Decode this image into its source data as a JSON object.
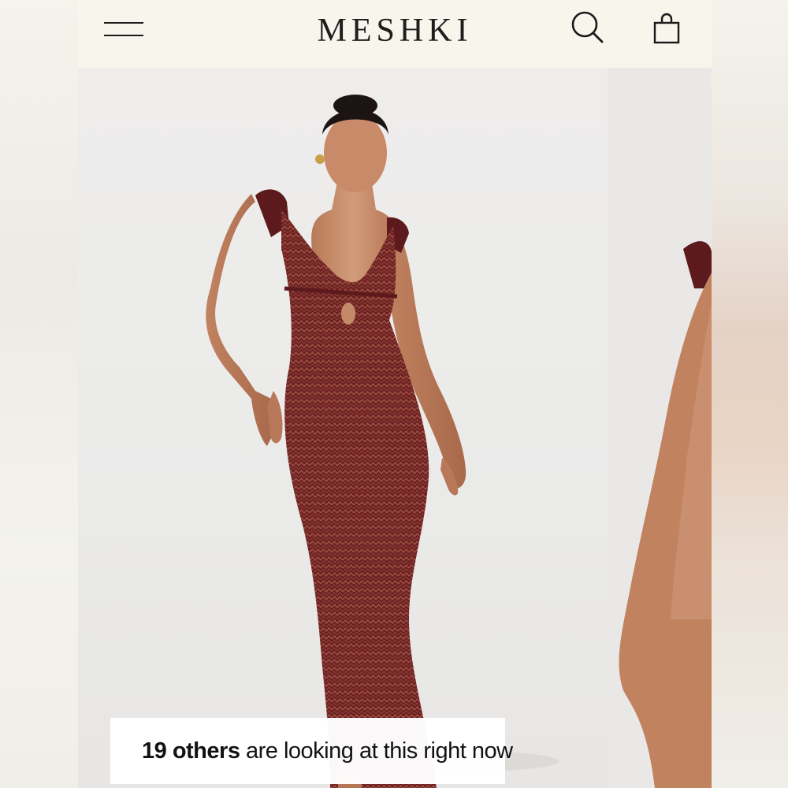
{
  "header": {
    "brand": "MESHKI",
    "menu_icon": "hamburger-menu-icon",
    "search_icon": "search-icon",
    "bag_icon": "shopping-bag-icon"
  },
  "product_gallery": {
    "dress_color": "#6b1f22",
    "background_color": "#ecebea"
  },
  "viewers_banner": {
    "count_text": "19 others",
    "message": " are looking at this right now"
  }
}
